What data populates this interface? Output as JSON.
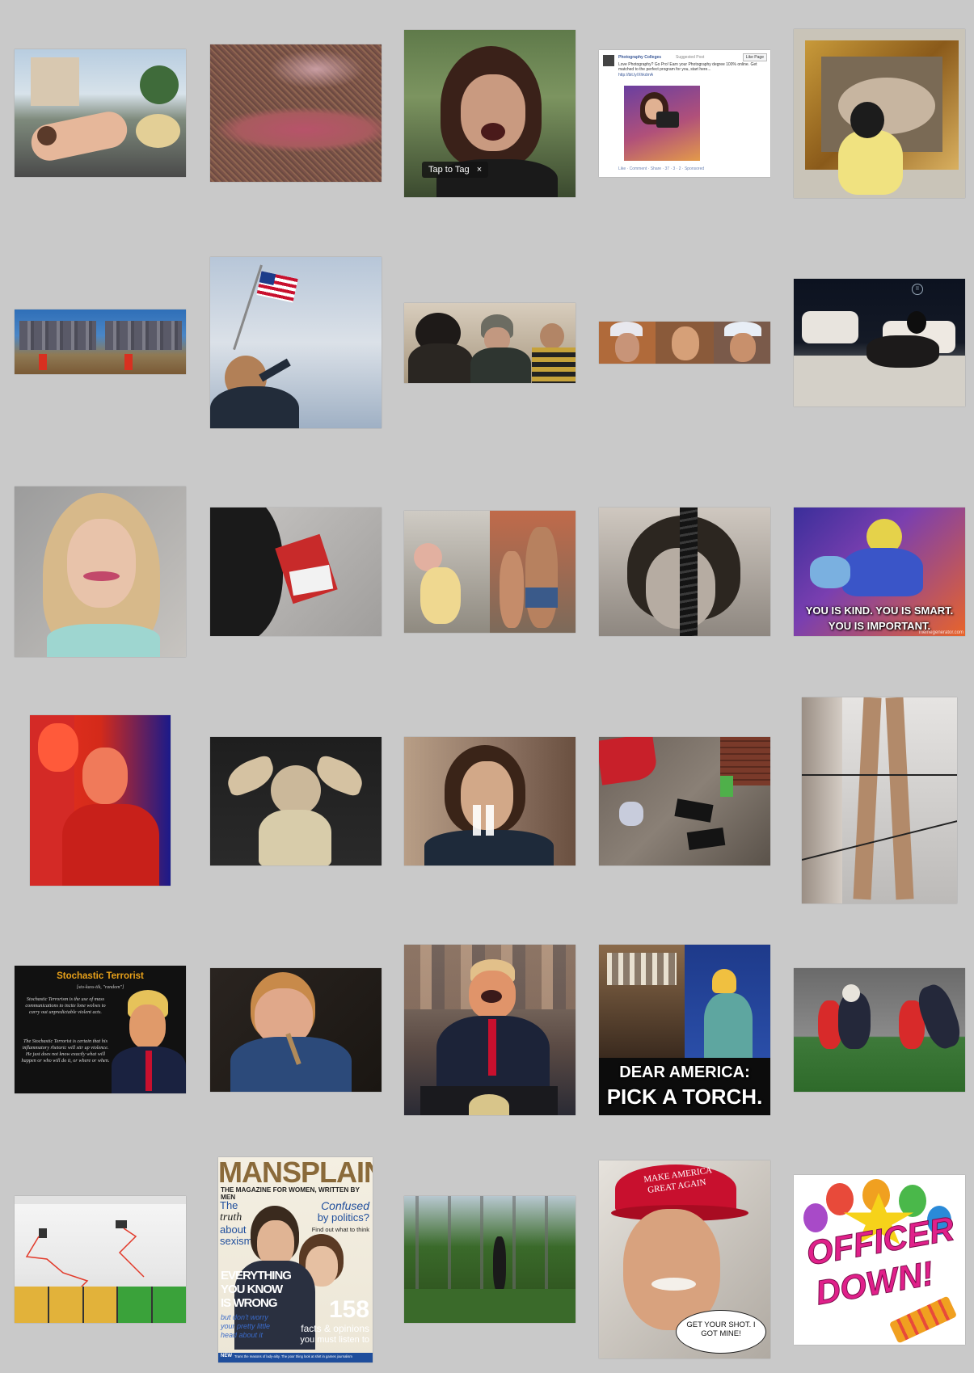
{
  "tiles": {
    "r1c3": {
      "tag_label": "Tap to Tag",
      "tag_close": "×"
    },
    "r1c4": {
      "page_name": "Photography Colleges",
      "post_meta": "Suggested Post",
      "like_button": "Like Page",
      "body": "Love Photography? Go Pro! Earn your Photography degree 100% online. Get matched to the perfect program for you, start here...",
      "link": "http://bit.ly/XhkdmA",
      "footer": "Like · Comment · Share · 37 · 3 · 2 · Sponsored"
    },
    "r3c5": {
      "line1": "YOU IS KIND. YOU IS SMART.",
      "line2": "YOU IS IMPORTANT.",
      "watermark": "memegenerator.com"
    },
    "r4c3": {
      "pause_icon": "pause-icon"
    },
    "r5c1": {
      "title": "Stochastic Terrorist",
      "pron": "[sto-kass-tik, \"random\"]",
      "def1": "Stochastic Terrorism is the use of mass communications to incite lone wolves to carry out unpredictable violent acts.",
      "def2": "The Stochastic Terrorist is certain that his inflammatory rhetoric will stir up violence. He just does not know exactly what will happen or who will do it, or where or when."
    },
    "r5c4": {
      "line1": "DEAR AMERICA:",
      "line2": "PICK A TORCH."
    },
    "r6c2": {
      "masthead": "MANSPLAIN",
      "tagline": "THE MAGAZINE FOR WOMEN, WRITTEN BY MEN",
      "left1": "The",
      "left2": "truth",
      "left3": "about",
      "left4": "sexism",
      "right1": "Confused",
      "right2": "by politics?",
      "right3": "Find out what to think",
      "big1": "EVERYTHING",
      "big2": "YOU KNOW",
      "big3": "IS WRONG",
      "sub1": "but don't worry",
      "sub2": "your pretty little",
      "sub3": "head about it",
      "number": "158",
      "num1": "facts & opinions",
      "num2": "you must listen to",
      "footer_new": "NEW",
      "footer": "Trans the reasons of lady-ality. The poor thing look at shirt in games journalism"
    },
    "r6c4": {
      "hat_line1": "MAKE AMERICA",
      "hat_line2": "GREAT AGAIN",
      "bubble": "GET YOUR SHOT.  I GOT MINE!"
    },
    "r6c5": {
      "line1": "OFFICER",
      "line2": "DOWN!"
    }
  },
  "colors": {
    "background": "#c9c9c9",
    "fb_blue": "#3b5998",
    "meme_gold": "#e8a11a",
    "mag_blue": "#1f4e9c",
    "officer_pink": "#e0208a"
  }
}
